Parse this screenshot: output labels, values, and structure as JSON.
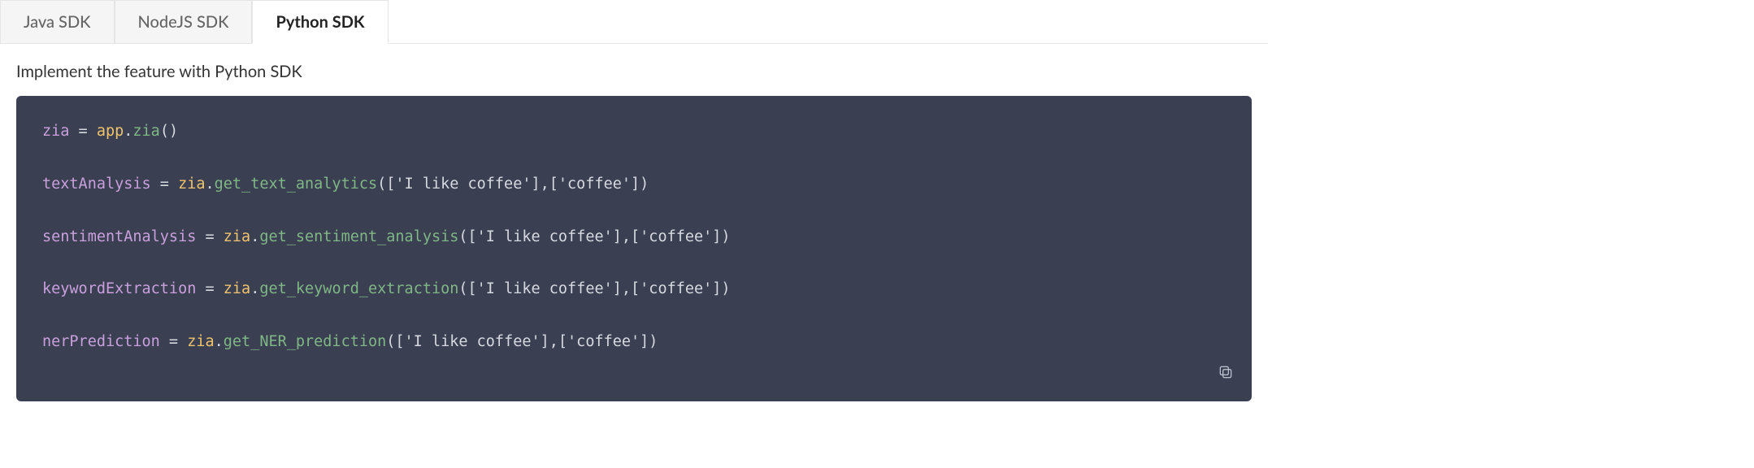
{
  "tabs": [
    {
      "label": "Java SDK",
      "active": false
    },
    {
      "label": "NodeJS SDK",
      "active": false
    },
    {
      "label": "Python SDK",
      "active": true
    }
  ],
  "description": "Implement the feature with Python SDK",
  "code": {
    "lines": [
      {
        "tokens": [
          {
            "cls": "tk-var",
            "t": "zia"
          },
          {
            "cls": "tk-op",
            "t": " = "
          },
          {
            "cls": "tk-obj",
            "t": "app"
          },
          {
            "cls": "tk-punc",
            "t": "."
          },
          {
            "cls": "tk-func",
            "t": "zia"
          },
          {
            "cls": "tk-punc",
            "t": "()"
          }
        ]
      },
      {
        "tokens": [
          {
            "cls": "tk-var",
            "t": "textAnalysis"
          },
          {
            "cls": "tk-op",
            "t": " = "
          },
          {
            "cls": "tk-obj",
            "t": "zia"
          },
          {
            "cls": "tk-punc",
            "t": "."
          },
          {
            "cls": "tk-func",
            "t": "get_text_analytics"
          },
          {
            "cls": "tk-punc",
            "t": "(["
          },
          {
            "cls": "tk-str",
            "t": "'I like coffee'"
          },
          {
            "cls": "tk-punc",
            "t": "],["
          },
          {
            "cls": "tk-str",
            "t": "'coffee'"
          },
          {
            "cls": "tk-punc",
            "t": "])"
          }
        ]
      },
      {
        "tokens": [
          {
            "cls": "tk-var",
            "t": "sentimentAnalysis"
          },
          {
            "cls": "tk-op",
            "t": " = "
          },
          {
            "cls": "tk-obj",
            "t": "zia"
          },
          {
            "cls": "tk-punc",
            "t": "."
          },
          {
            "cls": "tk-func",
            "t": "get_sentiment_analysis"
          },
          {
            "cls": "tk-punc",
            "t": "(["
          },
          {
            "cls": "tk-str",
            "t": "'I like coffee'"
          },
          {
            "cls": "tk-punc",
            "t": "],["
          },
          {
            "cls": "tk-str",
            "t": "'coffee'"
          },
          {
            "cls": "tk-punc",
            "t": "])"
          }
        ]
      },
      {
        "tokens": [
          {
            "cls": "tk-var",
            "t": "keywordExtraction"
          },
          {
            "cls": "tk-op",
            "t": " = "
          },
          {
            "cls": "tk-obj",
            "t": "zia"
          },
          {
            "cls": "tk-punc",
            "t": "."
          },
          {
            "cls": "tk-func",
            "t": "get_keyword_extraction"
          },
          {
            "cls": "tk-punc",
            "t": "(["
          },
          {
            "cls": "tk-str",
            "t": "'I like coffee'"
          },
          {
            "cls": "tk-punc",
            "t": "],["
          },
          {
            "cls": "tk-str",
            "t": "'coffee'"
          },
          {
            "cls": "tk-punc",
            "t": "])"
          }
        ]
      },
      {
        "tokens": [
          {
            "cls": "tk-var",
            "t": "nerPrediction"
          },
          {
            "cls": "tk-op",
            "t": " = "
          },
          {
            "cls": "tk-obj",
            "t": "zia"
          },
          {
            "cls": "tk-punc",
            "t": "."
          },
          {
            "cls": "tk-func",
            "t": "get_NER_prediction"
          },
          {
            "cls": "tk-punc",
            "t": "(["
          },
          {
            "cls": "tk-str",
            "t": "'I like coffee'"
          },
          {
            "cls": "tk-punc",
            "t": "],["
          },
          {
            "cls": "tk-str",
            "t": "'coffee'"
          },
          {
            "cls": "tk-punc",
            "t": "])"
          }
        ]
      }
    ]
  }
}
